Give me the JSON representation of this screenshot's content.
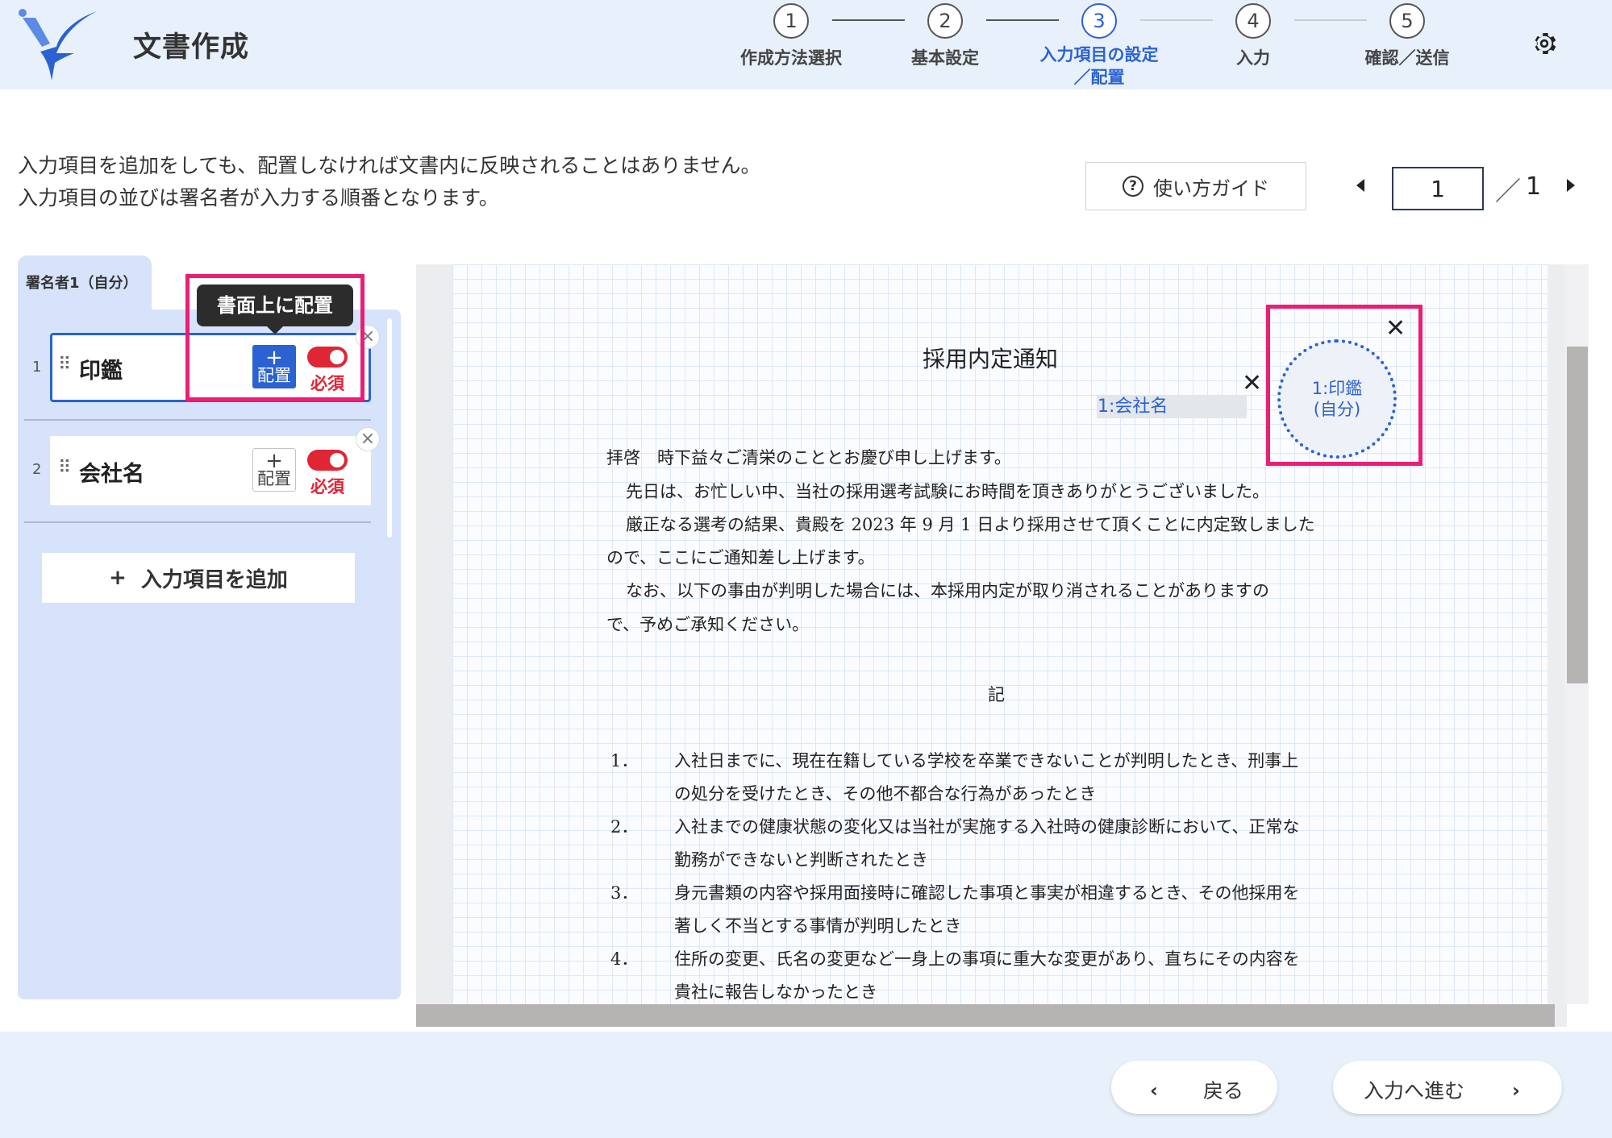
{
  "header": {
    "app_title": "文書作成",
    "steps": [
      {
        "number": "1",
        "label": "作成方法選択"
      },
      {
        "number": "2",
        "label": "基本設定"
      },
      {
        "number": "3",
        "label_line1": "入力項目の設定",
        "label_line2": "／配置"
      },
      {
        "number": "4",
        "label": "入力"
      },
      {
        "number": "5",
        "label": "確認／送信"
      }
    ],
    "settings_icon": "gear-icon"
  },
  "instructions": {
    "line1": "入力項目を追加をしても、配置しなければ文書内に反映されることはありません。",
    "line2": "入力項目の並びは署名者が入力する順番となります。"
  },
  "guide_button": {
    "label": "使い方ガイド",
    "icon": "help-circle-icon"
  },
  "pager": {
    "current": "1",
    "separator": "／",
    "total": "1"
  },
  "signer_tab": "署名者1（自分）",
  "tooltip": "書面上に配置",
  "fields": [
    {
      "index": "1",
      "name": "印鑑",
      "place_plus": "+",
      "place_label": "配置",
      "required_label": "必須",
      "required": true
    },
    {
      "index": "2",
      "name": "会社名",
      "place_plus": "+",
      "place_label": "配置",
      "required_label": "必須",
      "required": true
    }
  ],
  "remove_symbol": "×",
  "add_field_button": {
    "icon": "+",
    "label": "入力項目を追加"
  },
  "document": {
    "title": "採用内定通知",
    "company_placeholder": "1:会社名",
    "seal_line1": "1:印鑑",
    "seal_line2": "(自分)",
    "close_symbol": "✕",
    "lines": [
      "拝啓　時下益々ご清栄のこととお慶び申し上げます。",
      "先日は、お忙しい中、当社の採用選考試験にお時間を頂きありがとうございました。",
      "厳正なる選考の結果、貴殿を 2023 年 9 月 1 日より採用させて頂くことに内定致しました",
      "ので、ここにご通知差し上げます。",
      "なお、以下の事由が判明した場合には、本採用内定が取り消されることがありますの",
      "で、予めご承知ください。"
    ],
    "ki": "記",
    "items": [
      {
        "num": "1．",
        "line1": "入社日までに、現在在籍している学校を卒業できないことが判明したとき、刑事上",
        "line2": "の処分を受けたとき、その他不都合な行為があったとき"
      },
      {
        "num": "2．",
        "line1": "入社までの健康状態の変化又は当社が実施する入社時の健康診断において、正常な",
        "line2": "勤務ができないと判断されたとき"
      },
      {
        "num": "3．",
        "line1": "身元書類の内容や採用面接時に確認した事項と事実が相違するとき、その他採用を",
        "line2": "著しく不当とする事情が判明したとき"
      },
      {
        "num": "4．",
        "line1": "住所の変更、氏名の変更など一身上の事項に重大な変更があり、直ちにその内容を",
        "line2": "貴社に報告しなかったとき"
      }
    ]
  },
  "footer": {
    "back_label": "戻る",
    "next_label": "入力へ進む"
  },
  "colors": {
    "accent": "#2b62d3",
    "required": "#e02535",
    "highlight": "#ea1e74",
    "panel": "#d6e3fa",
    "header_bg": "#e8f0fb"
  }
}
